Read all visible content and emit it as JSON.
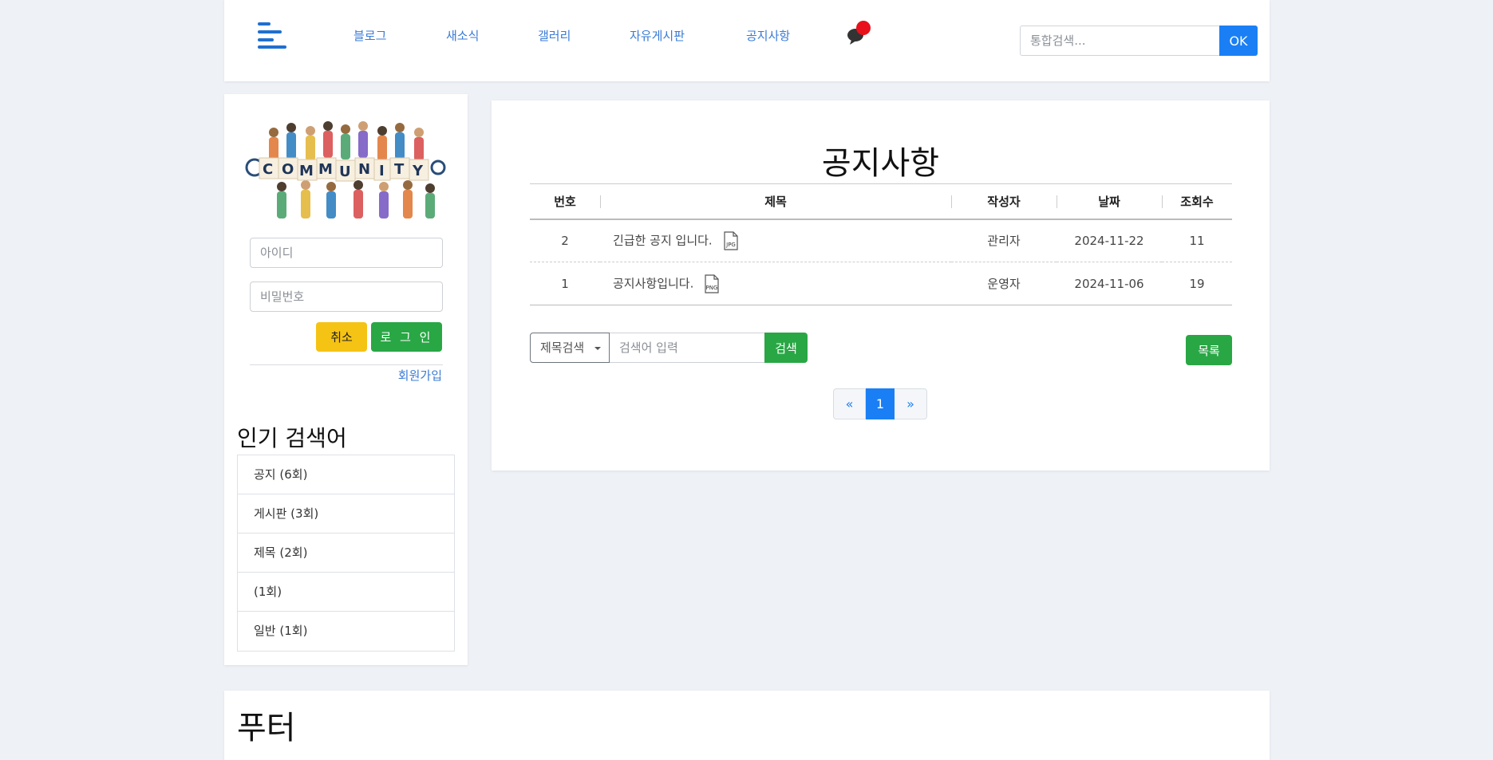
{
  "header": {
    "nav": [
      "블로그",
      "새소식",
      "갤러리",
      "자유게시판",
      "공지사항"
    ],
    "search_placeholder": "통합검색...",
    "search_button": "OK",
    "colors": {
      "accent": "#1a7ff5",
      "notification": "#e8101b"
    }
  },
  "sidebar": {
    "logo_text": "COMMUNITY",
    "id_placeholder": "아이디",
    "password_placeholder": "비밀번호",
    "cancel_label": "취소",
    "login_label": "로 그 인",
    "signup_label": "회원가입",
    "popular_title": "인기 검색어",
    "popular": [
      "공지 (6회)",
      "게시판 (3회)",
      "제목 (2회)",
      "(1회)",
      "일반 (1회)"
    ]
  },
  "main": {
    "title": "공지사항",
    "columns": [
      "번호",
      "제목",
      "작성자",
      "날짜",
      "조회수"
    ],
    "rows": [
      {
        "no": "2",
        "title": "긴급한 공지 입니다.",
        "file": "JPG",
        "author": "관리자",
        "date": "2024-11-22",
        "views": "11"
      },
      {
        "no": "1",
        "title": "공지사항입니다.",
        "file": "PNG",
        "author": "운영자",
        "date": "2024-11-06",
        "views": "19"
      }
    ],
    "search_type": "제목검색",
    "search_placeholder": "검색어 입력",
    "search_button": "검색",
    "list_button": "목록",
    "pagination": {
      "prev": "«",
      "current": "1",
      "next": "»"
    }
  },
  "footer": {
    "title": "푸터"
  }
}
